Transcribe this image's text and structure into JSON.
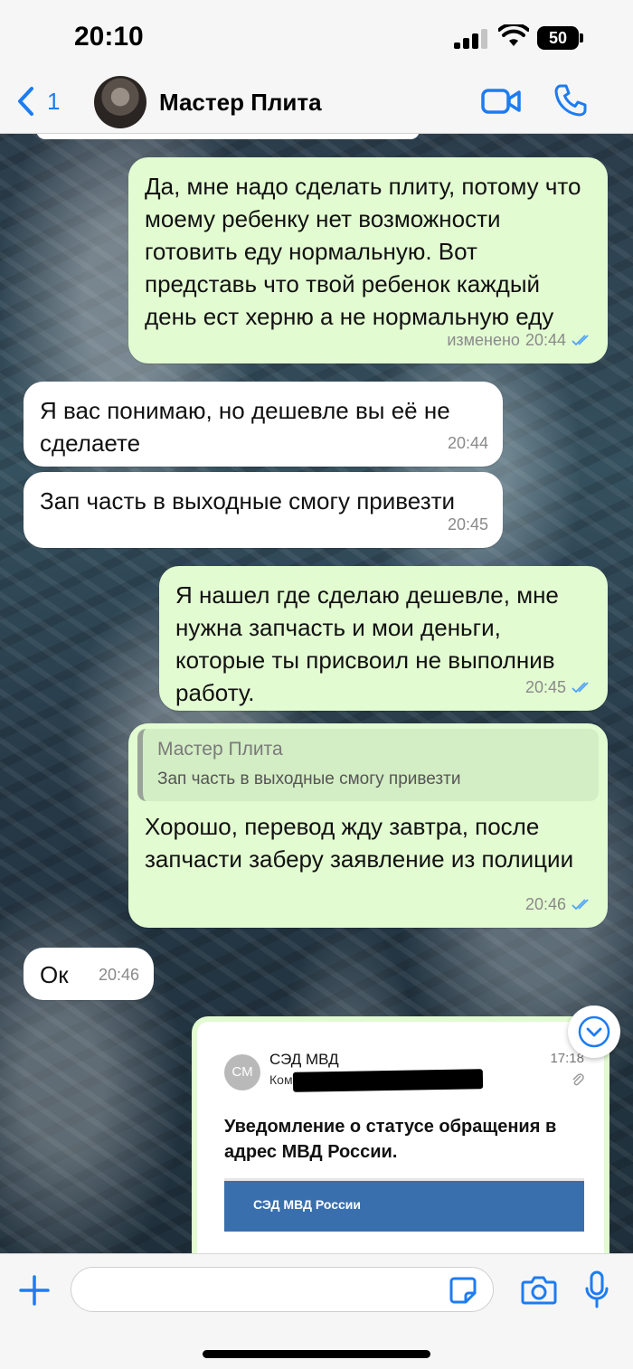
{
  "status_bar": {
    "time": "20:10",
    "battery": "50"
  },
  "header": {
    "back_count": "1",
    "contact_name": "Мастер Плита",
    "accent_color": "#1d7cf2"
  },
  "messages": [
    {
      "direction": "outgoing",
      "text": "Да, мне надо сделать плиту, потому что моему ребенку нет возможности готовить еду нормальную. Вот представь что твой ребенок каждый день ест херню а не нормальную еду",
      "edited": "изменено",
      "time": "20:44"
    },
    {
      "direction": "incoming",
      "text": "Я вас понимаю, но дешевле вы её не сделаете",
      "time": "20:44"
    },
    {
      "direction": "incoming",
      "text": "Зап часть в выходные смогу привезти",
      "time": "20:45"
    },
    {
      "direction": "outgoing",
      "text": "Я нашел где сделаю дешевле, мне нужна запчасть и мои деньги, которые ты присвоил не выполнив работу.",
      "time": "20:45"
    },
    {
      "direction": "outgoing",
      "reply_to": {
        "author": "Мастер Плита",
        "text": "Зап часть в выходные смогу привезти"
      },
      "text": "Хорошо, перевод жду завтра, после запчасти заберу заявление из полиции",
      "time": "20:46"
    },
    {
      "direction": "incoming",
      "text": "Ок",
      "time": "20:46"
    }
  ],
  "image_message": {
    "avatar_initials": "СМ",
    "sender": "СЭД МВД",
    "sender_sub": "Ком",
    "time": "17:18",
    "title": "Уведомление о статусе обращения в адрес МВД России.",
    "banner": "СЭД МВД России"
  },
  "input_bar": {
    "placeholder": ""
  },
  "colors": {
    "outgoing_bubble": "#e2fbd1",
    "incoming_bubble": "#ffffff",
    "read_ticks": "#4fa3f7"
  }
}
